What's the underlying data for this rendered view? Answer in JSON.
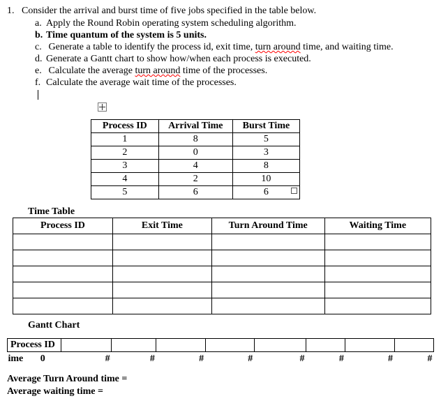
{
  "question": {
    "number": "1.",
    "text": "Consider the arrival and burst time of five jobs specified in the table below.",
    "items": {
      "a": "Apply the Round Robin operating system scheduling algorithm.",
      "b": "Time quantum of the system is 5 units.",
      "c_pre": "Generate a table to identify the process id, exit time, ",
      "c_wavy": "turn around",
      "c_post": " time, and waiting time.",
      "d": "Generate a Gantt chart to show how/when each process is executed.",
      "e_pre": "Calculate the average ",
      "e_wavy": "turn around",
      "e_post": " time of the processes.",
      "f": "Calculate the average wait time of the processes."
    }
  },
  "data_headers": {
    "pid": "Process ID",
    "arrival": "Arrival Time",
    "burst": "Burst Time"
  },
  "chart_data": {
    "type": "table",
    "title": "Process arrival and burst times",
    "columns": [
      "Process ID",
      "Arrival Time",
      "Burst Time"
    ],
    "rows": [
      {
        "pid": "1",
        "arrival": "8",
        "burst": "5"
      },
      {
        "pid": "2",
        "arrival": "0",
        "burst": "3"
      },
      {
        "pid": "3",
        "arrival": "4",
        "burst": "8"
      },
      {
        "pid": "4",
        "arrival": "2",
        "burst": "10"
      },
      {
        "pid": "5",
        "arrival": "6",
        "burst": "6"
      }
    ]
  },
  "time_table": {
    "title": "Time Table",
    "headers": {
      "pid": "Process ID",
      "exit": "Exit Time",
      "tat": "Turn Around Time",
      "wait": "Waiting Time"
    }
  },
  "gantt": {
    "title": "Gantt Chart",
    "row_label": "Process ID",
    "time_label": "ime",
    "start": "0",
    "mark": "#"
  },
  "averages": {
    "tat": "Average Turn Around time =",
    "wait": "Average waiting time ="
  }
}
